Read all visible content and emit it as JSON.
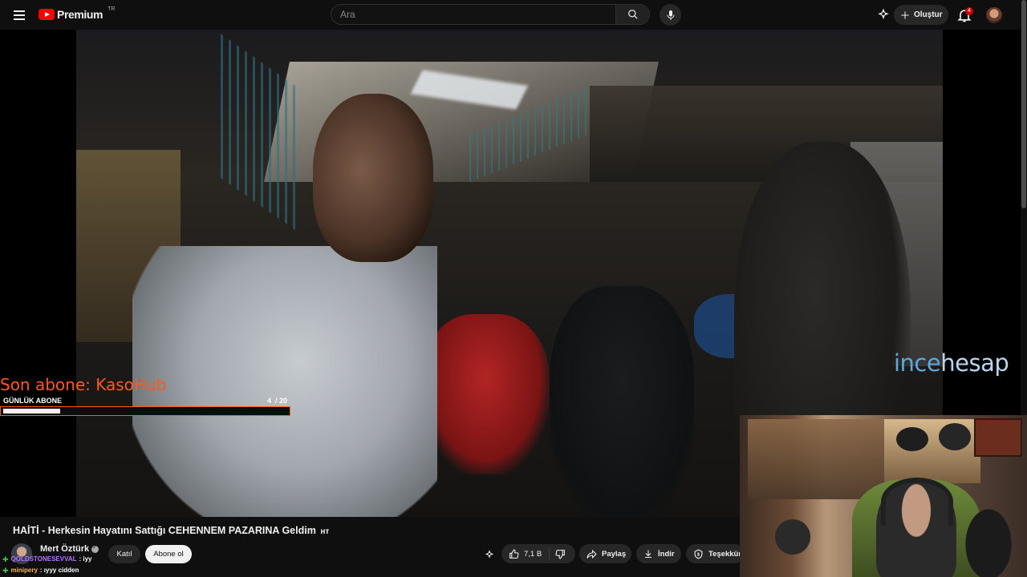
{
  "header": {
    "brand": "Premium",
    "region": "TR",
    "search_placeholder": "Ara",
    "create_label": "Oluştur",
    "notification_count": "4"
  },
  "player": {
    "watermark_a": "ince",
    "watermark_b": "hesap",
    "sub_goal": {
      "last_sub": "Son abone: KasoHub",
      "label": "GÜNLÜK ABONE",
      "current": "4",
      "target": "/ 20",
      "progress": 0.2
    }
  },
  "video": {
    "title": "HAİTİ - Herkesin Hayatını Sattığı CEHENNEM PAZARINA Geldim",
    "title_tag": "ʜᴛ",
    "channel_name": "Mert Öztürk",
    "join_label": "Katıl",
    "subscribe_label": "Abone ol",
    "likes": "7,1 B",
    "share_label": "Paylaş",
    "download_label": "İndir",
    "thanks_label": "Teşekkürl"
  },
  "chat": [
    {
      "user": "QOLDSTONESEVVAL",
      "message": ": iyy"
    },
    {
      "user": "minipery",
      "message": ": ıyyy cidden"
    }
  ],
  "colors": {
    "youtube_red": "#ff0000",
    "goal_orange": "#ff5a1f",
    "watermark_blue": "#5aa9dd"
  }
}
